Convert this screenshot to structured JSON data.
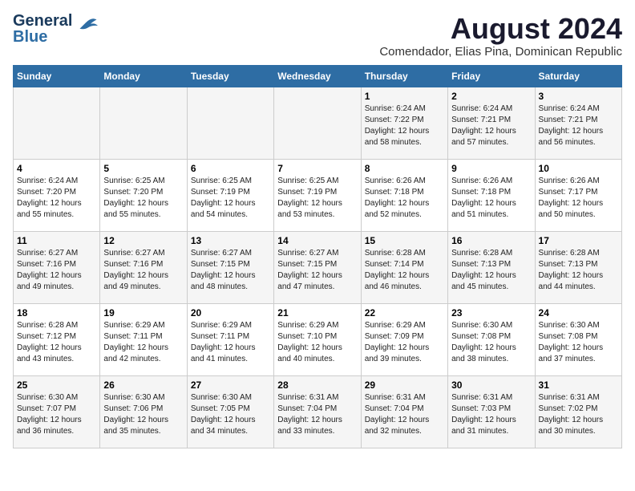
{
  "logo": {
    "line1": "General",
    "line2": "Blue"
  },
  "title": "August 2024",
  "subtitle": "Comendador, Elias Pina, Dominican Republic",
  "days_of_week": [
    "Sunday",
    "Monday",
    "Tuesday",
    "Wednesday",
    "Thursday",
    "Friday",
    "Saturday"
  ],
  "weeks": [
    [
      {
        "day": "",
        "sunrise": "",
        "sunset": "",
        "daylight": ""
      },
      {
        "day": "",
        "sunrise": "",
        "sunset": "",
        "daylight": ""
      },
      {
        "day": "",
        "sunrise": "",
        "sunset": "",
        "daylight": ""
      },
      {
        "day": "",
        "sunrise": "",
        "sunset": "",
        "daylight": ""
      },
      {
        "day": "1",
        "sunrise": "Sunrise: 6:24 AM",
        "sunset": "Sunset: 7:22 PM",
        "daylight": "Daylight: 12 hours and 58 minutes."
      },
      {
        "day": "2",
        "sunrise": "Sunrise: 6:24 AM",
        "sunset": "Sunset: 7:21 PM",
        "daylight": "Daylight: 12 hours and 57 minutes."
      },
      {
        "day": "3",
        "sunrise": "Sunrise: 6:24 AM",
        "sunset": "Sunset: 7:21 PM",
        "daylight": "Daylight: 12 hours and 56 minutes."
      }
    ],
    [
      {
        "day": "4",
        "sunrise": "Sunrise: 6:24 AM",
        "sunset": "Sunset: 7:20 PM",
        "daylight": "Daylight: 12 hours and 55 minutes."
      },
      {
        "day": "5",
        "sunrise": "Sunrise: 6:25 AM",
        "sunset": "Sunset: 7:20 PM",
        "daylight": "Daylight: 12 hours and 55 minutes."
      },
      {
        "day": "6",
        "sunrise": "Sunrise: 6:25 AM",
        "sunset": "Sunset: 7:19 PM",
        "daylight": "Daylight: 12 hours and 54 minutes."
      },
      {
        "day": "7",
        "sunrise": "Sunrise: 6:25 AM",
        "sunset": "Sunset: 7:19 PM",
        "daylight": "Daylight: 12 hours and 53 minutes."
      },
      {
        "day": "8",
        "sunrise": "Sunrise: 6:26 AM",
        "sunset": "Sunset: 7:18 PM",
        "daylight": "Daylight: 12 hours and 52 minutes."
      },
      {
        "day": "9",
        "sunrise": "Sunrise: 6:26 AM",
        "sunset": "Sunset: 7:18 PM",
        "daylight": "Daylight: 12 hours and 51 minutes."
      },
      {
        "day": "10",
        "sunrise": "Sunrise: 6:26 AM",
        "sunset": "Sunset: 7:17 PM",
        "daylight": "Daylight: 12 hours and 50 minutes."
      }
    ],
    [
      {
        "day": "11",
        "sunrise": "Sunrise: 6:27 AM",
        "sunset": "Sunset: 7:16 PM",
        "daylight": "Daylight: 12 hours and 49 minutes."
      },
      {
        "day": "12",
        "sunrise": "Sunrise: 6:27 AM",
        "sunset": "Sunset: 7:16 PM",
        "daylight": "Daylight: 12 hours and 49 minutes."
      },
      {
        "day": "13",
        "sunrise": "Sunrise: 6:27 AM",
        "sunset": "Sunset: 7:15 PM",
        "daylight": "Daylight: 12 hours and 48 minutes."
      },
      {
        "day": "14",
        "sunrise": "Sunrise: 6:27 AM",
        "sunset": "Sunset: 7:15 PM",
        "daylight": "Daylight: 12 hours and 47 minutes."
      },
      {
        "day": "15",
        "sunrise": "Sunrise: 6:28 AM",
        "sunset": "Sunset: 7:14 PM",
        "daylight": "Daylight: 12 hours and 46 minutes."
      },
      {
        "day": "16",
        "sunrise": "Sunrise: 6:28 AM",
        "sunset": "Sunset: 7:13 PM",
        "daylight": "Daylight: 12 hours and 45 minutes."
      },
      {
        "day": "17",
        "sunrise": "Sunrise: 6:28 AM",
        "sunset": "Sunset: 7:13 PM",
        "daylight": "Daylight: 12 hours and 44 minutes."
      }
    ],
    [
      {
        "day": "18",
        "sunrise": "Sunrise: 6:28 AM",
        "sunset": "Sunset: 7:12 PM",
        "daylight": "Daylight: 12 hours and 43 minutes."
      },
      {
        "day": "19",
        "sunrise": "Sunrise: 6:29 AM",
        "sunset": "Sunset: 7:11 PM",
        "daylight": "Daylight: 12 hours and 42 minutes."
      },
      {
        "day": "20",
        "sunrise": "Sunrise: 6:29 AM",
        "sunset": "Sunset: 7:11 PM",
        "daylight": "Daylight: 12 hours and 41 minutes."
      },
      {
        "day": "21",
        "sunrise": "Sunrise: 6:29 AM",
        "sunset": "Sunset: 7:10 PM",
        "daylight": "Daylight: 12 hours and 40 minutes."
      },
      {
        "day": "22",
        "sunrise": "Sunrise: 6:29 AM",
        "sunset": "Sunset: 7:09 PM",
        "daylight": "Daylight: 12 hours and 39 minutes."
      },
      {
        "day": "23",
        "sunrise": "Sunrise: 6:30 AM",
        "sunset": "Sunset: 7:08 PM",
        "daylight": "Daylight: 12 hours and 38 minutes."
      },
      {
        "day": "24",
        "sunrise": "Sunrise: 6:30 AM",
        "sunset": "Sunset: 7:08 PM",
        "daylight": "Daylight: 12 hours and 37 minutes."
      }
    ],
    [
      {
        "day": "25",
        "sunrise": "Sunrise: 6:30 AM",
        "sunset": "Sunset: 7:07 PM",
        "daylight": "Daylight: 12 hours and 36 minutes."
      },
      {
        "day": "26",
        "sunrise": "Sunrise: 6:30 AM",
        "sunset": "Sunset: 7:06 PM",
        "daylight": "Daylight: 12 hours and 35 minutes."
      },
      {
        "day": "27",
        "sunrise": "Sunrise: 6:30 AM",
        "sunset": "Sunset: 7:05 PM",
        "daylight": "Daylight: 12 hours and 34 minutes."
      },
      {
        "day": "28",
        "sunrise": "Sunrise: 6:31 AM",
        "sunset": "Sunset: 7:04 PM",
        "daylight": "Daylight: 12 hours and 33 minutes."
      },
      {
        "day": "29",
        "sunrise": "Sunrise: 6:31 AM",
        "sunset": "Sunset: 7:04 PM",
        "daylight": "Daylight: 12 hours and 32 minutes."
      },
      {
        "day": "30",
        "sunrise": "Sunrise: 6:31 AM",
        "sunset": "Sunset: 7:03 PM",
        "daylight": "Daylight: 12 hours and 31 minutes."
      },
      {
        "day": "31",
        "sunrise": "Sunrise: 6:31 AM",
        "sunset": "Sunset: 7:02 PM",
        "daylight": "Daylight: 12 hours and 30 minutes."
      }
    ]
  ]
}
